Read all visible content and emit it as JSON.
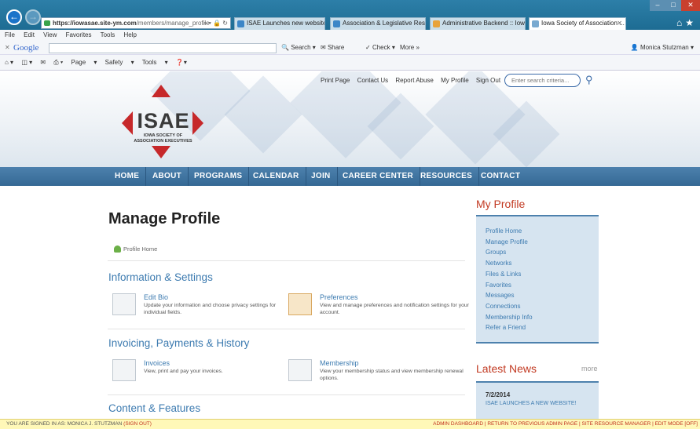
{
  "browser": {
    "url_host": "https://iowasae.site-ym.com",
    "url_path": "/members/manage_profile",
    "tabs": [
      {
        "label": "ISAE Launches new website - ..."
      },
      {
        "label": "Association & Legislative Reso..."
      },
      {
        "label": "Administrative Backend :: Iowa..."
      },
      {
        "label": "Iowa Society of Association ..."
      }
    ],
    "menu": [
      "File",
      "Edit",
      "View",
      "Favorites",
      "Tools",
      "Help"
    ],
    "google": {
      "logo": "Google",
      "search": "Search",
      "share": "Share",
      "check": "Check",
      "more": "More »",
      "user": "Monica Stutzman"
    },
    "cmd": [
      "Page",
      "Safety",
      "Tools"
    ]
  },
  "site": {
    "top_links": [
      "Print Page",
      "Contact Us",
      "Report Abuse",
      "My Profile",
      "Sign Out"
    ],
    "search_placeholder": "Enter search criteria...",
    "logo_text": "ISAE",
    "logo_sub": [
      "IOWA SOCIETY OF",
      "ASSOCIATION EXECUTIVES"
    ],
    "nav": [
      "HOME",
      "ABOUT",
      "PROGRAMS",
      "CALENDAR",
      "JOIN",
      "CAREER CENTER",
      "RESOURCES",
      "CONTACT"
    ]
  },
  "main": {
    "title": "Manage Profile",
    "crumb": "Profile Home",
    "sections": [
      {
        "title": "Information & Settings",
        "items": [
          {
            "title": "Edit Bio",
            "desc": "Update your information and choose privacy settings for individual fields.",
            "icon": "id-card-icon"
          },
          {
            "title": "Preferences",
            "desc": "View and manage preferences and notification settings for your account.",
            "icon": "preferences-icon"
          }
        ]
      },
      {
        "title": "Invoicing, Payments & History",
        "items": [
          {
            "title": "Invoices",
            "desc": "View, print and pay your invoices.",
            "icon": "invoice-icon"
          },
          {
            "title": "Membership",
            "desc": "View your membership status and view membership renewal options.",
            "icon": "membership-icon"
          }
        ]
      },
      {
        "title": "Content & Features",
        "items": []
      }
    ]
  },
  "sidebar": {
    "title": "My Profile",
    "links": [
      "Profile Home",
      "Manage Profile",
      "Groups",
      "Networks",
      "Files & Links",
      "Favorites",
      "Messages",
      "Connections",
      "Membership Info",
      "Refer a Friend"
    ],
    "news_title": "Latest News",
    "news_more": "more",
    "news": [
      {
        "date": "7/2/2014",
        "headline": "ISAE LAUNCHES A NEW WEBSITE!"
      }
    ]
  },
  "status": {
    "signed_in_prefix": "YOU ARE SIGNED IN AS: MONICA J. STUTZMAN",
    "sign_out": "(SIGN OUT)",
    "right": "ADMIN DASHBOARD | RETURN TO PREVIOUS ADMIN PAGE | SITE RESOURCE MANAGER | EDIT MODE [OFF]"
  }
}
